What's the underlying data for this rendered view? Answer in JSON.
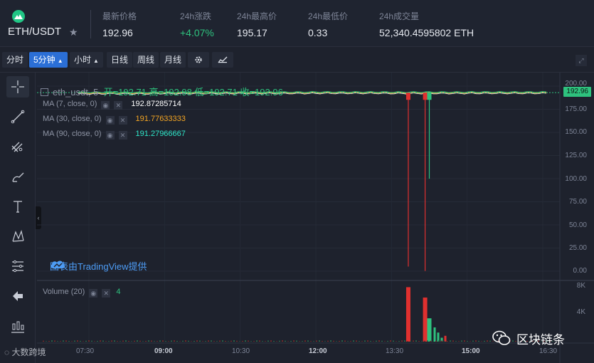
{
  "header": {
    "pair": "ETH/USDT",
    "stats": [
      {
        "label": "最新价格",
        "value": "192.96"
      },
      {
        "label": "24h涨跌",
        "value": "+4.07%"
      },
      {
        "label": "24h最高价",
        "value": "195.17"
      },
      {
        "label": "24h最低价",
        "value": "0.33"
      },
      {
        "label": "24h成交量",
        "value": "52,340.4595802 ETH"
      }
    ]
  },
  "toolbar": {
    "intervals": [
      "分时",
      "5分钟",
      "小时",
      "日线",
      "周线",
      "月线"
    ],
    "selected": "5分钟"
  },
  "chart": {
    "symbol": "eth_usdt, 5",
    "ohlc": "开=192.71  高=192.98  低=192.71  收=192.96",
    "ma": [
      {
        "label": "MA (7, close, 0)",
        "value": "192.87285714",
        "color": "#ffffff"
      },
      {
        "label": "MA (30, close, 0)",
        "value": "191.77633333",
        "color": "#f5a623"
      },
      {
        "label": "MA (90, close, 0)",
        "value": "191.27966667",
        "color": "#2ee6c8"
      }
    ],
    "credit": "图表由TradingView提供",
    "last_price": "192.96",
    "price_axis": [
      "200.00",
      "175.00",
      "150.00",
      "125.00",
      "100.00",
      "75.00",
      "50.00",
      "25.00",
      "0.00"
    ],
    "volume_label": "Volume (20)",
    "volume_value": "4",
    "volume_axis": [
      "8K",
      "4K"
    ],
    "time_axis": [
      "07:30",
      "09:00",
      "10:30",
      "12:00",
      "13:30",
      "15:00",
      "16:30"
    ],
    "colors": {
      "up": "#2ec27e",
      "down": "#e0302f",
      "accent": "#2b6fd6"
    }
  },
  "chart_data": {
    "type": "bar",
    "x": [
      "07:30",
      "09:00",
      "10:30",
      "12:00",
      "13:30",
      "15:00",
      "16:30"
    ],
    "ylim": [
      0,
      200
    ],
    "series": [
      {
        "values": [
          192.5,
          192.7,
          192.8,
          192.9,
          192.8,
          192.9,
          192.96
        ]
      }
    ],
    "volume_ylim": [
      0,
      9000
    ],
    "spikes": [
      {
        "time": "13:50",
        "low": 5,
        "volume": 8400
      },
      {
        "time": "14:10",
        "low": 0.33,
        "volume": 6800
      },
      {
        "time": "14:15",
        "low": 100,
        "volume": 3600
      }
    ]
  },
  "watermarks": {
    "left": "大数跨境",
    "right": "区块链条"
  }
}
